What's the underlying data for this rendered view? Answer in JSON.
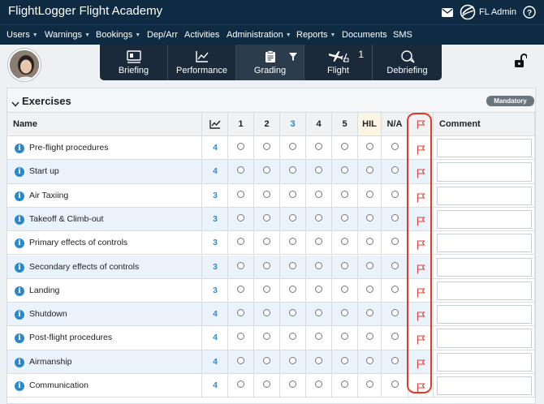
{
  "app": {
    "title": "FlightLogger Flight Academy",
    "user_name": "FL Admin"
  },
  "nav": [
    {
      "label": "Users",
      "caret": true
    },
    {
      "label": "Warnings",
      "caret": true
    },
    {
      "label": "Bookings",
      "caret": true
    },
    {
      "label": "Dep/Arr",
      "caret": false
    },
    {
      "label": "Activities",
      "caret": false
    },
    {
      "label": "Administration",
      "caret": true
    },
    {
      "label": "Reports",
      "caret": true
    },
    {
      "label": "Documents",
      "caret": false
    },
    {
      "label": "SMS",
      "caret": false
    }
  ],
  "tabs": [
    {
      "label": "Briefing",
      "icon": "briefing-icon"
    },
    {
      "label": "Performance",
      "icon": "chart-line-icon"
    },
    {
      "label": "Grading",
      "icon": "clipboard-icon",
      "active": true
    },
    {
      "label": "Flight",
      "icon": "plane-icon",
      "count": "1"
    },
    {
      "label": "Debriefing",
      "icon": "chat-icon"
    }
  ],
  "exercises": {
    "title": "Exercises",
    "badge": "Mandatory",
    "columns": {
      "name": "Name",
      "grades": [
        "1",
        "2",
        "3",
        "4",
        "5"
      ],
      "highlight_grade": "3",
      "hil": "HIL",
      "na": "N/A",
      "comment": "Comment"
    },
    "rows": [
      {
        "name": "Pre-flight procedures",
        "trend": "4"
      },
      {
        "name": "Start up",
        "trend": "4"
      },
      {
        "name": "Air Taxiing",
        "trend": "3"
      },
      {
        "name": "Takeoff & Climb-out",
        "trend": "3"
      },
      {
        "name": "Primary effects of controls",
        "trend": "3"
      },
      {
        "name": "Secondary effects of controls",
        "trend": "3"
      },
      {
        "name": "Landing",
        "trend": "3"
      },
      {
        "name": "Shutdown",
        "trend": "4"
      },
      {
        "name": "Post-flight procedures",
        "trend": "4"
      },
      {
        "name": "Airmanship",
        "trend": "4"
      },
      {
        "name": "Communication",
        "trend": "4"
      }
    ]
  },
  "colors": {
    "header_bg": "#0f2b44",
    "accent": "#2c87c8",
    "highlight": "#e03a2b",
    "flag": "#d8453b"
  }
}
